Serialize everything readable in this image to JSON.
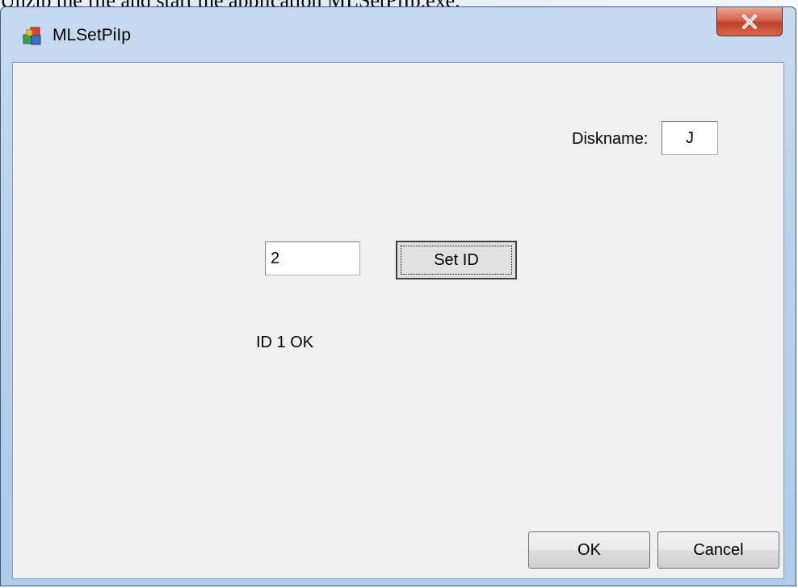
{
  "document": {
    "caption": "Unzip the file and start the application MLSetPiIp.exe."
  },
  "window": {
    "title": "MLSetPiIp",
    "close_glyph": "x-icon"
  },
  "form": {
    "diskname_label": "Diskname:",
    "diskname_value": "J",
    "id_value": "2",
    "set_id_label": "Set ID",
    "status_text": "ID 1 OK",
    "ok_label": "OK",
    "cancel_label": "Cancel"
  }
}
